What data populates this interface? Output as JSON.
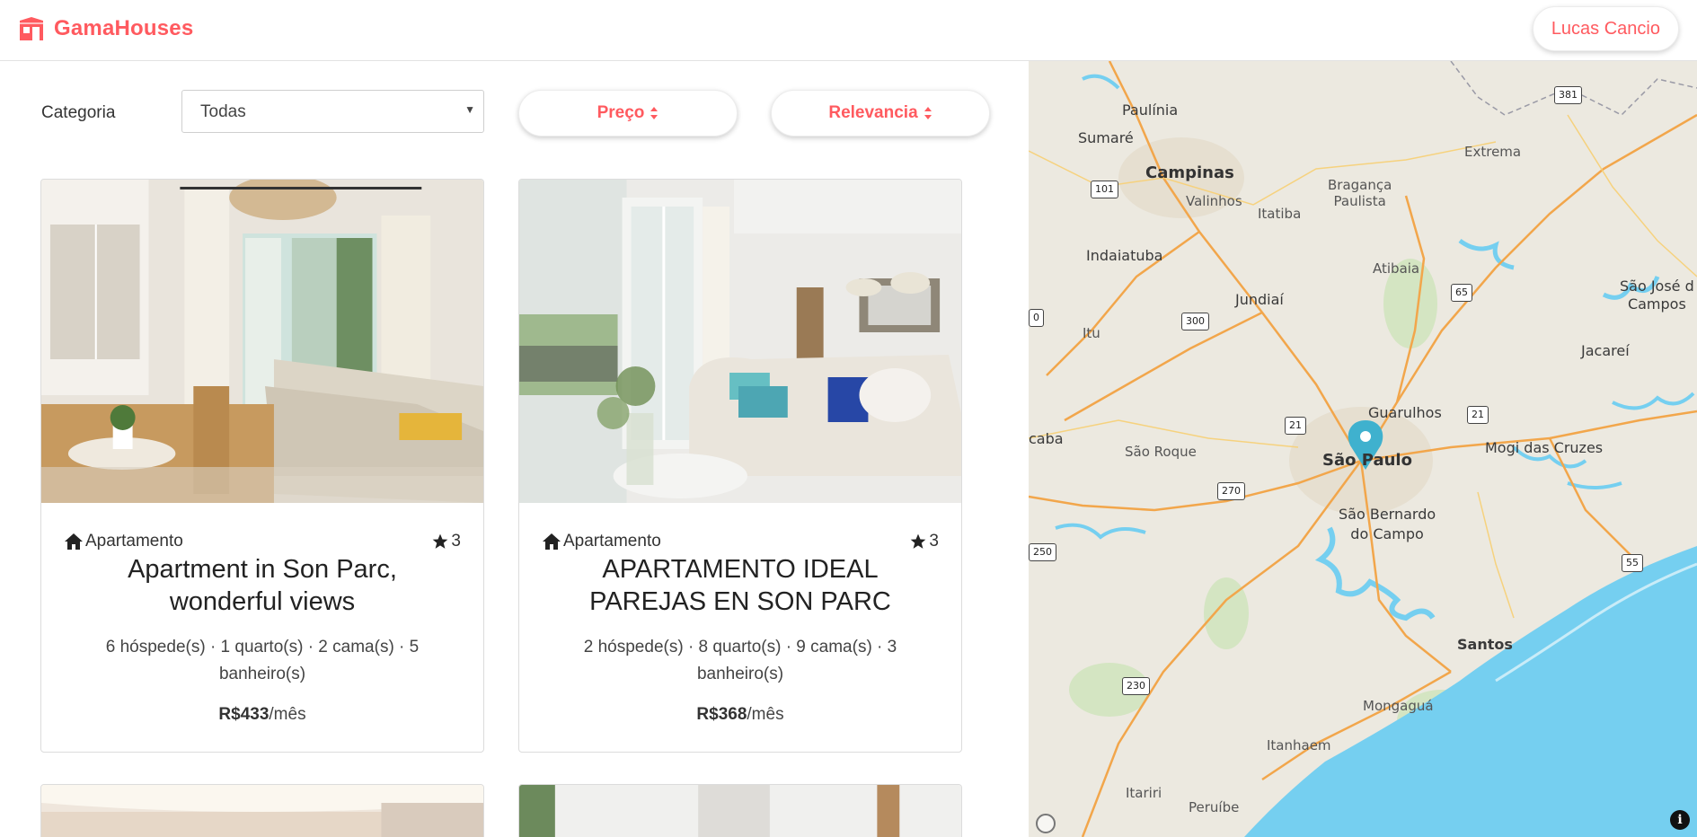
{
  "header": {
    "brand_name": "GamaHouses",
    "user_name": "Lucas Cancio",
    "brand_color": "#ff5a5f"
  },
  "filters": {
    "category_label": "Categoria",
    "category_value": "Todas",
    "price_sort_label": "Preço",
    "relevance_sort_label": "Relevancia"
  },
  "listings": [
    {
      "type": "Apartamento",
      "rating": "3",
      "title": "Apartment in Son Parc, wonderful views",
      "details": "6 hóspede(s) · 1 quarto(s) · 2 cama(s) · 5 banheiro(s)",
      "price": "R$433",
      "period": "/mês"
    },
    {
      "type": "Apartamento",
      "rating": "3",
      "title": "APARTAMENTO IDEAL PAREJAS EN SON PARC",
      "details": "2 hóspede(s) · 8 quarto(s) · 9 cama(s) · 3 banheiro(s)",
      "price": "R$368",
      "period": "/mês"
    }
  ],
  "map": {
    "labels": {
      "paulinia": "Paulínia",
      "sumare": "Sumaré",
      "campinas": "Campinas",
      "valinhos": "Valinhos",
      "itatiba": "Itatiba",
      "braganca": "Bragança\nPaulista",
      "extrema": "Extrema",
      "indaiatuba": "Indaiatuba",
      "jundiai": "Jundiaí",
      "atibaia": "Atibaia",
      "sjcampos": "São José d\nCampos",
      "itu": "Itu",
      "jacarei": "Jacareí",
      "guarulhos": "Guarulhos",
      "caba": "caba",
      "sao_roque": "São Roque",
      "sao_paulo": "São Paulo",
      "mogi": "Mogi das Cruzes",
      "sbc": "São Bernardo\ndo Campo",
      "santos": "Santos",
      "mongagua": "Mongaguá",
      "itanhaem": "Itanhaem",
      "itariri": "Itariri",
      "peruibe": "Peruíbe"
    },
    "shields": {
      "s381": "381",
      "s101": "101",
      "s65": "65",
      "s300": "300",
      "s0": "0",
      "s21a": "21",
      "s21b": "21",
      "s270": "270",
      "s250": "250",
      "s55": "55",
      "s230": "230"
    },
    "marker_color": "#3fb1ce",
    "water_color": "#75cff0"
  }
}
